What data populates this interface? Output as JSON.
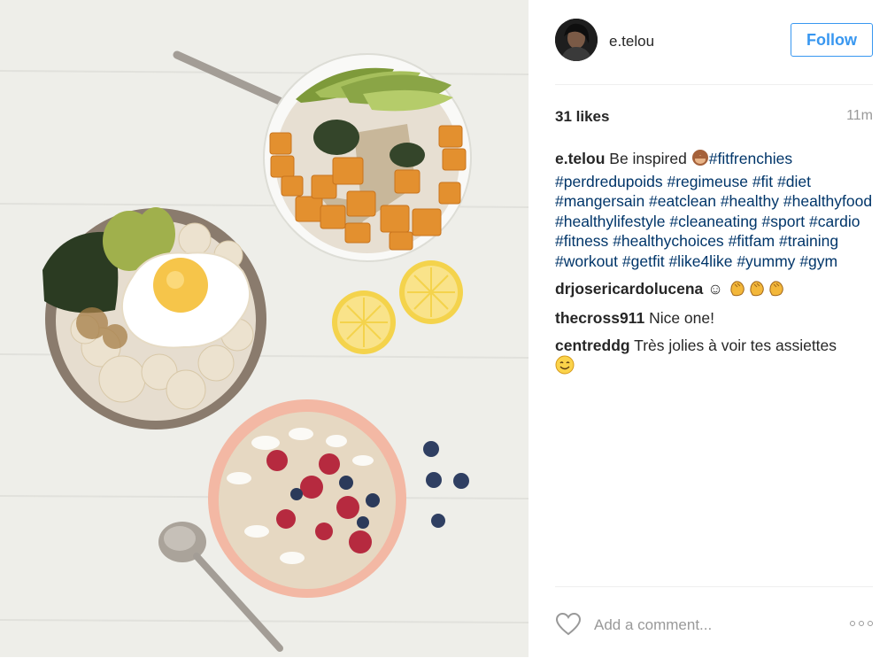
{
  "header": {
    "username": "e.telou",
    "follow_label": "Follow"
  },
  "stats": {
    "likes": "31 likes",
    "time_ago": "11m"
  },
  "caption": {
    "username": "e.telou",
    "text": "Be inspired",
    "emoji": "monkey-covering-eyes",
    "hashtags": [
      "#fitfrenchies",
      "#perdredupoids",
      "#regimeuse",
      "#fit",
      "#diet",
      "#mangersain",
      "#eatclean",
      "#healthy",
      "#healthyfood",
      "#healthylifestyle",
      "#cleaneating",
      "#sport",
      "#cardio",
      "#fitness",
      "#healthychoices",
      "#fitfam",
      "#training",
      "#workout",
      "#getfit",
      "#like4like",
      "#yummy",
      "#gym"
    ]
  },
  "comments": [
    {
      "username": "drjosericardolucena",
      "text": "☺",
      "emoji": [
        "clapping-hands",
        "clapping-hands",
        "clapping-hands"
      ]
    },
    {
      "username": "thecross911",
      "text": "Nice one!"
    },
    {
      "username": "centreddg",
      "text": "Très jolies à voir tes assiettes",
      "emoji": [
        "smiling-face-with-smiling-eyes"
      ]
    }
  ],
  "footer": {
    "comment_placeholder": "Add a comment..."
  },
  "colors": {
    "accent": "#3897f0",
    "hashtag": "#003569",
    "muted": "#999999",
    "text": "#262626"
  }
}
